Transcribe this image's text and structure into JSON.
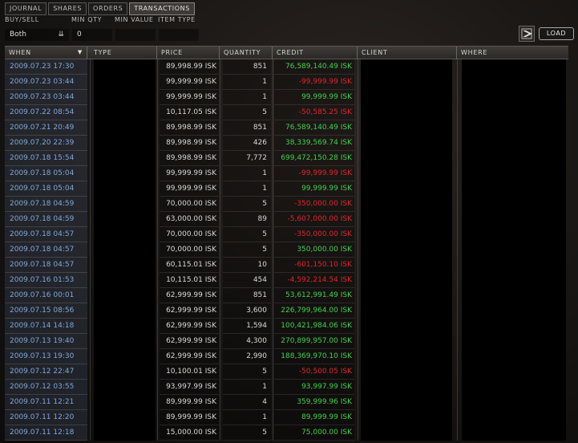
{
  "tabs": [
    {
      "label": "JOURNAL",
      "active": false
    },
    {
      "label": "SHARES",
      "active": false
    },
    {
      "label": "ORDERS",
      "active": false
    },
    {
      "label": "TRANSACTIONS",
      "active": true
    }
  ],
  "filters": {
    "buysell_label": "BUY/SELL",
    "minqty_label": "MIN QTY",
    "minvalue_label": "MIN VALUE",
    "itemtype_label": "ITEM TYPE",
    "buysell_value": "Both",
    "minqty_value": "0",
    "minvalue_value": "",
    "itemtype_value": ""
  },
  "toolbar": {
    "load_label": "LOAD"
  },
  "table": {
    "columns": [
      "WHEN",
      "TYPE",
      "PRICE",
      "QUANTITY",
      "CREDIT",
      "CLIENT",
      "WHERE"
    ],
    "rows": [
      {
        "when": "2009.07.23  17:30",
        "price": "89,998.99  ISK",
        "qty": "851",
        "credit": "76,589,140.49  ISK",
        "sign": "pos"
      },
      {
        "when": "2009.07.23  03:44",
        "price": "99,999.99  ISK",
        "qty": "1",
        "credit": "-99,999.99  ISK",
        "sign": "neg"
      },
      {
        "when": "2009.07.23  03:44",
        "price": "99,999.99  ISK",
        "qty": "1",
        "credit": "99,999.99  ISK",
        "sign": "pos"
      },
      {
        "when": "2009.07.22  08:54",
        "price": "10,117.05  ISK",
        "qty": "5",
        "credit": "-50,585.25  ISK",
        "sign": "neg"
      },
      {
        "when": "2009.07.21  20:49",
        "price": "89,998.99  ISK",
        "qty": "851",
        "credit": "76,589,140.49  ISK",
        "sign": "pos"
      },
      {
        "when": "2009.07.20  22:39",
        "price": "89,998.99  ISK",
        "qty": "426",
        "credit": "38,339,569.74  ISK",
        "sign": "pos"
      },
      {
        "when": "2009.07.18  15:54",
        "price": "89,998.99  ISK",
        "qty": "7,772",
        "credit": "699,472,150.28  ISK",
        "sign": "pos"
      },
      {
        "when": "2009.07.18  05:04",
        "price": "99,999.99  ISK",
        "qty": "1",
        "credit": "-99,999.99  ISK",
        "sign": "neg"
      },
      {
        "when": "2009.07.18  05:04",
        "price": "99,999.99  ISK",
        "qty": "1",
        "credit": "99,999.99  ISK",
        "sign": "pos"
      },
      {
        "when": "2009.07.18  04:59",
        "price": "70,000.00  ISK",
        "qty": "5",
        "credit": "-350,000.00  ISK",
        "sign": "neg"
      },
      {
        "when": "2009.07.18  04:59",
        "price": "63,000.00  ISK",
        "qty": "89",
        "credit": "-5,607,000.00  ISK",
        "sign": "neg"
      },
      {
        "when": "2009.07.18  04:57",
        "price": "70,000.00  ISK",
        "qty": "5",
        "credit": "-350,000.00  ISK",
        "sign": "neg"
      },
      {
        "when": "2009.07.18  04:57",
        "price": "70,000.00  ISK",
        "qty": "5",
        "credit": "350,000.00  ISK",
        "sign": "pos"
      },
      {
        "when": "2009.07.18  04:57",
        "price": "60,115.01  ISK",
        "qty": "10",
        "credit": "-601,150.10  ISK",
        "sign": "neg"
      },
      {
        "when": "2009.07.16  01:53",
        "price": "10,115.01  ISK",
        "qty": "454",
        "credit": "-4,592,214.54  ISK",
        "sign": "neg"
      },
      {
        "when": "2009.07.16  00:01",
        "price": "62,999.99  ISK",
        "qty": "851",
        "credit": "53,612,991.49  ISK",
        "sign": "pos"
      },
      {
        "when": "2009.07.15  08:56",
        "price": "62,999.99  ISK",
        "qty": "3,600",
        "credit": "226,799,964.00  ISK",
        "sign": "pos"
      },
      {
        "when": "2009.07.14  14:18",
        "price": "62,999.99  ISK",
        "qty": "1,594",
        "credit": "100,421,984.06  ISK",
        "sign": "pos"
      },
      {
        "when": "2009.07.13  19:40",
        "price": "62,999.99  ISK",
        "qty": "4,300",
        "credit": "270,899,957.00  ISK",
        "sign": "pos"
      },
      {
        "when": "2009.07.13  19:30",
        "price": "62,999.99  ISK",
        "qty": "2,990",
        "credit": "188,369,970.10  ISK",
        "sign": "pos"
      },
      {
        "when": "2009.07.12  22:47",
        "price": "10,100.01  ISK",
        "qty": "5",
        "credit": "-50,500.05  ISK",
        "sign": "neg"
      },
      {
        "when": "2009.07.12  03:55",
        "price": "93,997.99  ISK",
        "qty": "1",
        "credit": "93,997.99  ISK",
        "sign": "pos"
      },
      {
        "when": "2009.07.11  12:21",
        "price": "89,999.99  ISK",
        "qty": "4",
        "credit": "359,999.96  ISK",
        "sign": "pos"
      },
      {
        "when": "2009.07.11  12:20",
        "price": "89,999.99  ISK",
        "qty": "1",
        "credit": "89,999.99  ISK",
        "sign": "pos"
      },
      {
        "when": "2009.07.11  12:18",
        "price": "15,000.00  ISK",
        "qty": "5",
        "credit": "75,000.00  ISK",
        "sign": "pos"
      }
    ]
  },
  "colors": {
    "positive": "#3fd24a",
    "negative": "#e0262b",
    "date": "#7fa7d9"
  },
  "icons": {
    "sort": "triangle-down",
    "dropdown": "double-chevron-down",
    "export": "export-arrow"
  }
}
